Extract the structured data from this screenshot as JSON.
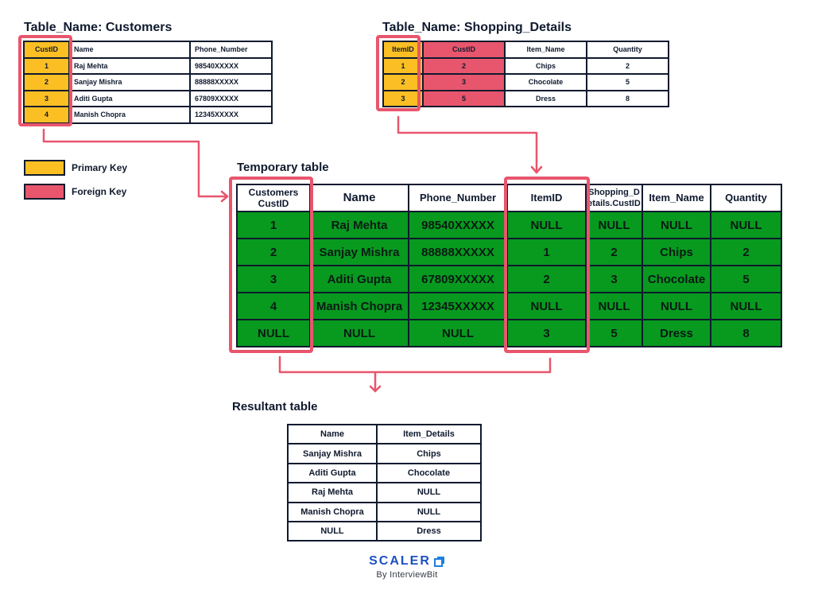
{
  "colors": {
    "primary_key": "#fbbf24",
    "foreign_key": "#e8566d",
    "highlight": "#e8566d",
    "joined_row": "#079a1f",
    "border": "#0f1a2e",
    "brand": "#1d4fc4"
  },
  "customers": {
    "title": "Table_Name: Customers",
    "headers": [
      "CustID",
      "Name",
      "Phone_Number"
    ],
    "rows": [
      [
        "1",
        "Raj Mehta",
        "98540XXXXX"
      ],
      [
        "2",
        "Sanjay Mishra",
        "88888XXXXX"
      ],
      [
        "3",
        "Aditi Gupta",
        "67809XXXXX"
      ],
      [
        "4",
        "Manish Chopra",
        "12345XXXXX"
      ]
    ]
  },
  "shopping": {
    "title": "Table_Name: Shopping_Details",
    "headers": [
      "ItemID",
      "CustID",
      "Item_Name",
      "Quantity"
    ],
    "rows": [
      [
        "1",
        "2",
        "Chips",
        "2"
      ],
      [
        "2",
        "3",
        "Chocolate",
        "5"
      ],
      [
        "3",
        "5",
        "Dress",
        "8"
      ]
    ]
  },
  "legend": {
    "primary_key": "Primary Key",
    "foreign_key": "Foreign Key"
  },
  "temporary": {
    "title": "Temporary table",
    "headers": [
      "Customers CustID",
      "Name",
      "Phone_Number",
      "ItemID",
      "Shopping_Details.CustID",
      "Item_Name",
      "Quantity"
    ],
    "header_display": {
      "h0_line1": "Customers",
      "h0_line2": "CustID",
      "h4_line1": "Shopping_D",
      "h4_line2": "etails.CustID"
    },
    "rows": [
      [
        "1",
        "Raj Mehta",
        "98540XXXXX",
        "NULL",
        "NULL",
        "NULL",
        "NULL"
      ],
      [
        "2",
        "Sanjay Mishra",
        "88888XXXXX",
        "1",
        "2",
        "Chips",
        "2"
      ],
      [
        "3",
        "Aditi Gupta",
        "67809XXXXX",
        "2",
        "3",
        "Chocolate",
        "5"
      ],
      [
        "4",
        "Manish Chopra",
        "12345XXXXX",
        "NULL",
        "NULL",
        "NULL",
        "NULL"
      ],
      [
        "NULL",
        "NULL",
        "NULL",
        "3",
        "5",
        "Dress",
        "8"
      ]
    ]
  },
  "resultant": {
    "title": "Resultant table",
    "headers": [
      "Name",
      "Item_Details"
    ],
    "rows": [
      [
        "Sanjay Mishra",
        "Chips"
      ],
      [
        "Aditi Gupta",
        "Chocolate"
      ],
      [
        "Raj Mehta",
        "NULL"
      ],
      [
        "Manish Chopra",
        "NULL"
      ],
      [
        "NULL",
        "Dress"
      ]
    ]
  },
  "logo": {
    "name": "SCALER",
    "tagline": "By InterviewBit",
    "icon": "scaler-cube-icon"
  }
}
